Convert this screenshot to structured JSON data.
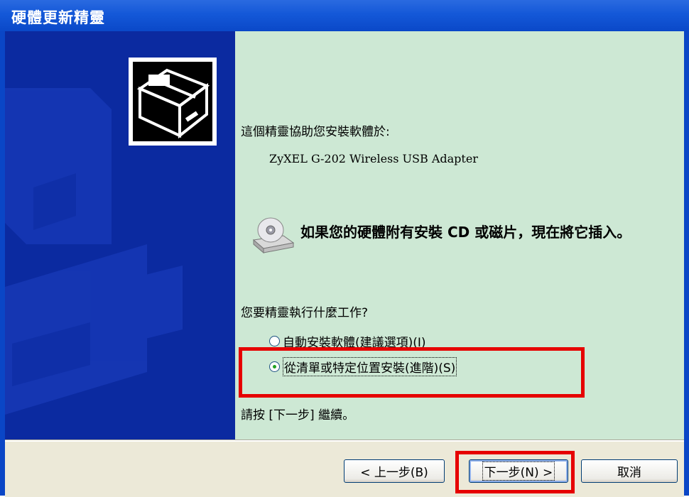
{
  "window": {
    "title": "硬體更新精靈"
  },
  "intro": {
    "text": "這個精靈協助您安裝軟體於:"
  },
  "device": {
    "name": "ZyXEL G-202 Wireless USB Adapter"
  },
  "cd_prompt": {
    "text": "如果您的硬體附有安裝 CD 或磁片，現在將它插入。"
  },
  "question": {
    "text": "您要精靈執行什麼工作?"
  },
  "options": [
    {
      "label": "自動安裝軟體(建議選項)(I)",
      "checked": false
    },
    {
      "label": "從清單或特定位置安裝(進階)(S)",
      "checked": true
    }
  ],
  "continue": {
    "text": "請按 [下一步] 繼續。"
  },
  "buttons": {
    "back": "< 上一步(B)",
    "next": "下一步(N) >",
    "cancel": "取消"
  },
  "colors": {
    "title_bar": "#1458d8",
    "side_panel": "#0b2aa0",
    "main_panel": "#cde8d4",
    "highlight": "#e60000"
  },
  "icons": {
    "hardware": "hardware-install-icon",
    "cd": "cd-drive-icon"
  }
}
